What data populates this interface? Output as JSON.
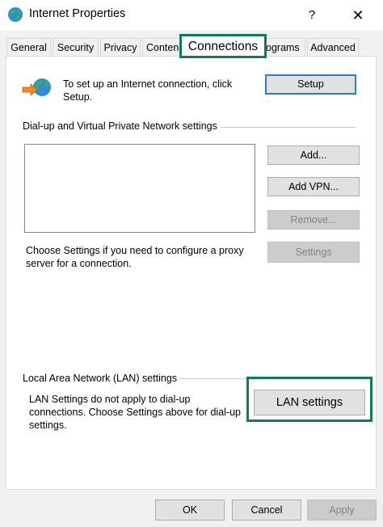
{
  "window": {
    "title": "Internet Properties",
    "help_glyph": "?",
    "close_glyph": "✕"
  },
  "tabs": [
    {
      "label": "General"
    },
    {
      "label": "Security"
    },
    {
      "label": "Privacy"
    },
    {
      "label": "Conten"
    },
    {
      "label": "Connections",
      "selected": true
    },
    {
      "label": "ograms"
    },
    {
      "label": "Advanced"
    }
  ],
  "setup": {
    "description": "To set up an Internet connection, click Setup.",
    "button_label": "Setup"
  },
  "dialup": {
    "group_title": "Dial-up and Virtual Private Network settings",
    "add_label": "Add...",
    "add_vpn_label": "Add VPN...",
    "remove_label": "Remove...",
    "settings_label": "Settings",
    "proxy_text": "Choose Settings if you need to configure a proxy server for a connection."
  },
  "lan": {
    "group_title": "Local Area Network (LAN) settings",
    "description": "LAN Settings do not apply to dial-up connections. Choose Settings above for dial-up settings.",
    "button_label": "LAN settings"
  },
  "footer": {
    "ok_label": "OK",
    "cancel_label": "Cancel",
    "apply_label": "Apply"
  },
  "colors": {
    "highlight": "#0e7b5f",
    "default_button_border": "#2c7ad6",
    "disabled_text": "#838383"
  }
}
